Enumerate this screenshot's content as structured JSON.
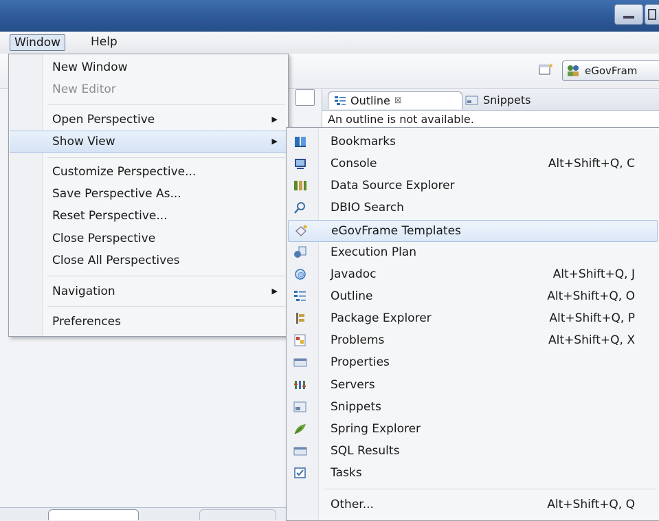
{
  "menubar": {
    "items": [
      {
        "label": "Window"
      },
      {
        "label": "Help"
      }
    ]
  },
  "perspective": {
    "label": "eGovFram"
  },
  "views": {
    "outline_tab": "Outline",
    "outline_close": "⊠",
    "snippets_tab": "Snippets",
    "outline_message": "An outline is not available."
  },
  "window_menu": {
    "items": [
      {
        "label": "New Window"
      },
      {
        "label": "New Editor",
        "disabled": true
      },
      {
        "label": "Open Perspective",
        "submenu": true
      },
      {
        "label": "Show View",
        "submenu": true
      },
      {
        "label": "Customize Perspective..."
      },
      {
        "label": "Save Perspective As..."
      },
      {
        "label": "Reset Perspective..."
      },
      {
        "label": "Close Perspective"
      },
      {
        "label": "Close All Perspectives"
      },
      {
        "label": "Navigation",
        "submenu": true
      },
      {
        "label": "Preferences"
      }
    ]
  },
  "show_view_menu": {
    "items": [
      {
        "label": "Bookmarks",
        "shortcut": "",
        "icon": "bookmarks-icon",
        "color": "#2c6fb7"
      },
      {
        "label": "Console",
        "shortcut": "Alt+Shift+Q, C",
        "icon": "console-icon",
        "color": "#2a4f8f"
      },
      {
        "label": "Data Source Explorer",
        "shortcut": "",
        "icon": "data-source-icon",
        "color": "#5a8a2a"
      },
      {
        "label": "DBIO Search",
        "shortcut": "",
        "icon": "search-icon",
        "color": "#3b6fa8"
      },
      {
        "label": "eGovFrame Templates",
        "shortcut": "",
        "icon": "templates-icon",
        "color": "#9a9aa5"
      },
      {
        "label": "Execution Plan",
        "shortcut": "",
        "icon": "execution-plan-icon",
        "color": "#4d7db5"
      },
      {
        "label": "Javadoc",
        "shortcut": "Alt+Shift+Q, J",
        "icon": "javadoc-icon",
        "color": "#3b78c4"
      },
      {
        "label": "Outline",
        "shortcut": "Alt+Shift+Q, O",
        "icon": "outline-icon",
        "color": "#2c6fb7"
      },
      {
        "label": "Package Explorer",
        "shortcut": "Alt+Shift+Q, P",
        "icon": "package-explorer-icon",
        "color": "#c8a040"
      },
      {
        "label": "Problems",
        "shortcut": "Alt+Shift+Q, X",
        "icon": "problems-icon",
        "color": "#c24a3a"
      },
      {
        "label": "Properties",
        "shortcut": "",
        "icon": "properties-icon",
        "color": "#6b87b0"
      },
      {
        "label": "Servers",
        "shortcut": "",
        "icon": "servers-icon",
        "color": "#4a7a4a"
      },
      {
        "label": "Snippets",
        "shortcut": "",
        "icon": "snippets-icon",
        "color": "#6a86a8"
      },
      {
        "label": "Spring Explorer",
        "shortcut": "",
        "icon": "spring-icon",
        "color": "#6aa33a"
      },
      {
        "label": "SQL Results",
        "shortcut": "",
        "icon": "sql-results-icon",
        "color": "#6b87b0"
      },
      {
        "label": "Tasks",
        "shortcut": "",
        "icon": "tasks-icon",
        "color": "#3a6aa8"
      },
      {
        "label": "Other...",
        "shortcut": "Alt+Shift+Q, Q",
        "icon": "",
        "color": ""
      }
    ]
  }
}
